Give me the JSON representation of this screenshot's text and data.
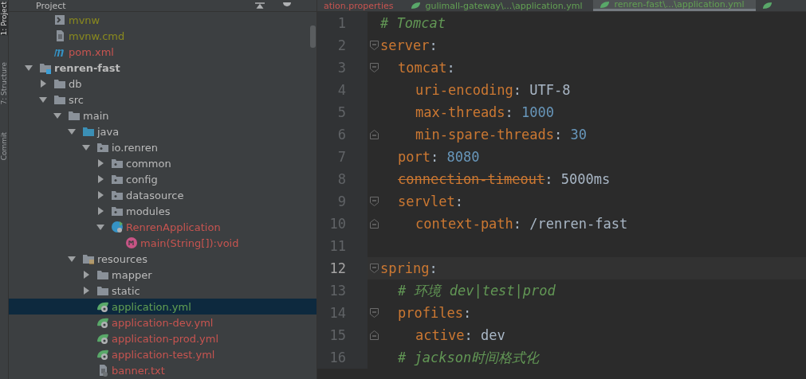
{
  "tool_strip": [
    {
      "label": "1: Project",
      "selected": true
    },
    {
      "label": "7: Structure",
      "selected": false
    },
    {
      "label": "Commit",
      "selected": false
    }
  ],
  "project_header": {
    "title": "Project"
  },
  "tree_partial": [
    {
      "name": "mvnw",
      "kind": "script",
      "color": "#8a8a1e"
    },
    {
      "name": "mvnw.cmd",
      "kind": "text",
      "color": "#8a8a1e"
    },
    {
      "name": "pom.xml",
      "kind": "maven",
      "color": "#c75450"
    }
  ],
  "tree": [
    {
      "name": "renren-fast",
      "kind": "module",
      "color": "#bbbbbb",
      "bold": true,
      "expanded": true,
      "children": [
        {
          "name": "db",
          "kind": "folder",
          "color": "#bbbbbb",
          "expanded": false
        },
        {
          "name": "src",
          "kind": "folder",
          "color": "#bbbbbb",
          "expanded": true,
          "children": [
            {
              "name": "main",
              "kind": "folder",
              "color": "#bbbbbb",
              "expanded": true,
              "children": [
                {
                  "name": "java",
                  "kind": "source",
                  "color": "#bbbbbb",
                  "expanded": true,
                  "children": [
                    {
                      "name": "io.renren",
                      "kind": "package",
                      "color": "#bbbbbb",
                      "expanded": true,
                      "children": [
                        {
                          "name": "common",
                          "kind": "package",
                          "color": "#bbbbbb",
                          "expanded": false
                        },
                        {
                          "name": "config",
                          "kind": "package",
                          "color": "#bbbbbb",
                          "expanded": false
                        },
                        {
                          "name": "datasource",
                          "kind": "package",
                          "color": "#bbbbbb",
                          "expanded": false
                        },
                        {
                          "name": "modules",
                          "kind": "package",
                          "color": "#bbbbbb",
                          "expanded": false
                        },
                        {
                          "name": "RenrenApplication",
                          "kind": "springclass",
                          "color": "#c75450",
                          "expanded": true,
                          "children": [
                            {
                              "name": "main(String[]):void",
                              "kind": "method",
                              "color": "#c75450"
                            }
                          ]
                        }
                      ]
                    }
                  ]
                },
                {
                  "name": "resources",
                  "kind": "resources",
                  "color": "#bbbbbb",
                  "expanded": true,
                  "children": [
                    {
                      "name": "mapper",
                      "kind": "folder",
                      "color": "#bbbbbb",
                      "expanded": false
                    },
                    {
                      "name": "static",
                      "kind": "folder",
                      "color": "#bbbbbb",
                      "expanded": false
                    },
                    {
                      "name": "application.yml",
                      "kind": "config",
                      "color": "#62a053",
                      "selected": true
                    },
                    {
                      "name": "application-dev.yml",
                      "kind": "config",
                      "color": "#c75450",
                      "selected": false
                    },
                    {
                      "name": "application-prod.yml",
                      "kind": "config",
                      "color": "#c75450",
                      "selected": false
                    },
                    {
                      "name": "application-test.yml",
                      "kind": "config",
                      "color": "#c75450",
                      "selected": false
                    },
                    {
                      "name": "banner.txt",
                      "kind": "textfile",
                      "color": "#c75450",
                      "selected": false
                    }
                  ]
                }
              ]
            }
          ]
        }
      ]
    }
  ],
  "editor_tabs": [
    {
      "label": "ation.properties",
      "color": "#c75450",
      "selected": false
    },
    {
      "label": "gulimall-gateway\\...\\application.yml",
      "color": "#62a053",
      "selected": false
    },
    {
      "label": "renren-fast\\...\\application.yml",
      "color": "#62a053",
      "selected": true
    },
    {
      "selected": false
    }
  ],
  "code_lines": [
    {
      "number": "1",
      "fold_open": false,
      "fold_close": false,
      "current": false,
      "tokens": [
        {
          "kind": "comment",
          "text": "# Tomcat"
        }
      ]
    },
    {
      "number": "2",
      "fold_open": true,
      "fold_close": false,
      "current": false,
      "tokens": [
        {
          "kind": "key",
          "text": "server"
        },
        {
          "kind": "punct",
          "text": ":"
        }
      ],
      "children": [
        {
          "number": "3",
          "fold_open": true,
          "fold_close": false,
          "current": false,
          "tokens": [
            {
              "kind": "key",
              "text": "tomcat"
            },
            {
              "kind": "punct",
              "text": ":"
            }
          ],
          "children": [
            {
              "number": "4",
              "fold_open": false,
              "fold_close": false,
              "current": false,
              "tokens": [
                {
                  "kind": "key",
                  "text": "uri-encoding"
                },
                {
                  "kind": "punct",
                  "text": ": "
                },
                {
                  "kind": "plain",
                  "text": "UTF-8"
                }
              ]
            },
            {
              "number": "5",
              "fold_open": false,
              "fold_close": false,
              "current": false,
              "tokens": [
                {
                  "kind": "key",
                  "text": "max-threads"
                },
                {
                  "kind": "punct",
                  "text": ": "
                },
                {
                  "kind": "number",
                  "text": "1000"
                }
              ]
            },
            {
              "number": "6",
              "fold_open": false,
              "fold_close": true,
              "current": false,
              "tokens": [
                {
                  "kind": "key",
                  "text": "min-spare-threads"
                },
                {
                  "kind": "punct",
                  "text": ": "
                },
                {
                  "kind": "number",
                  "text": "30"
                }
              ]
            }
          ]
        },
        {
          "number": "7",
          "fold_open": false,
          "fold_close": false,
          "current": false,
          "tokens": [
            {
              "kind": "key",
              "text": "port"
            },
            {
              "kind": "punct",
              "text": ": "
            },
            {
              "kind": "number",
              "text": "8080"
            }
          ]
        },
        {
          "number": "8",
          "fold_open": false,
          "fold_close": false,
          "current": false,
          "tokens": [
            {
              "kind": "deprecated",
              "text": "connection-timeout"
            },
            {
              "kind": "punct",
              "text": ": "
            },
            {
              "kind": "plain",
              "text": "5000ms"
            }
          ]
        },
        {
          "number": "9",
          "fold_open": true,
          "fold_close": false,
          "current": false,
          "tokens": [
            {
              "kind": "key",
              "text": "servlet"
            },
            {
              "kind": "punct",
              "text": ":"
            }
          ],
          "children": [
            {
              "number": "10",
              "fold_open": false,
              "fold_close": true,
              "current": false,
              "tokens": [
                {
                  "kind": "key",
                  "text": "context-path"
                },
                {
                  "kind": "punct",
                  "text": ": "
                },
                {
                  "kind": "plain",
                  "text": "/renren-fast"
                }
              ]
            }
          ]
        }
      ]
    },
    {
      "number": "11",
      "fold_open": false,
      "fold_close": false,
      "current": false
    },
    {
      "number": "12",
      "fold_open": true,
      "fold_close": false,
      "current": true,
      "tokens": [
        {
          "kind": "key",
          "text": "spring"
        },
        {
          "kind": "punct",
          "text": ":"
        }
      ],
      "children": [
        {
          "number": "13",
          "fold_open": false,
          "fold_close": false,
          "current": false,
          "tokens": [
            {
              "kind": "comment",
              "text": "# 环境 dev|test|prod"
            }
          ]
        },
        {
          "number": "14",
          "fold_open": true,
          "fold_close": false,
          "current": false,
          "tokens": [
            {
              "kind": "key",
              "text": "profiles"
            },
            {
              "kind": "punct",
              "text": ":"
            }
          ],
          "children": [
            {
              "number": "15",
              "fold_open": false,
              "fold_close": true,
              "current": false,
              "tokens": [
                {
                  "kind": "key",
                  "text": "active"
                },
                {
                  "kind": "punct",
                  "text": ": "
                },
                {
                  "kind": "plain",
                  "text": "dev"
                }
              ]
            }
          ]
        },
        {
          "number": "16",
          "fold_open": false,
          "fold_close": false,
          "current": false,
          "tokens": [
            {
              "kind": "comment",
              "text": "# jackson时间格式化"
            }
          ]
        }
      ]
    }
  ]
}
